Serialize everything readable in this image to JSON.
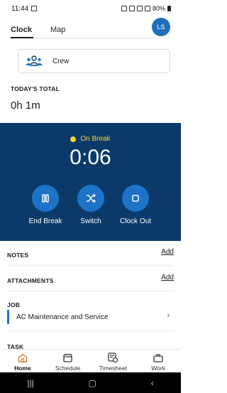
{
  "status_bar": {
    "time": "11:44",
    "battery": "80%"
  },
  "tabs": [
    {
      "label": "Clock",
      "active": true
    },
    {
      "label": "Map",
      "active": false
    }
  ],
  "avatar": {
    "initials": "LS",
    "color": "#1f6fb8"
  },
  "crew": {
    "label": "Crew",
    "icon": "crew-icon"
  },
  "today": {
    "label": "TODAY'S TOTAL",
    "value": "0h 1m"
  },
  "break_panel": {
    "status": "On Break",
    "timer": "0:06",
    "background": "#0b3a6a",
    "status_color": "#f5d13a",
    "actions": [
      {
        "label": "End Break",
        "icon": "pause-icon"
      },
      {
        "label": "Switch",
        "icon": "shuffle-icon"
      },
      {
        "label": "Clock Out",
        "icon": "stop-icon"
      }
    ]
  },
  "sections": {
    "notes": {
      "title": "NOTES",
      "action": "Add"
    },
    "attachments": {
      "title": "ATTACHMENTS",
      "action": "Add"
    },
    "job": {
      "title": "JOB",
      "value": "AC Maintenance and Service"
    },
    "task": {
      "title": "TASK"
    }
  },
  "bottom_nav": [
    {
      "label": "Home",
      "icon": "home-icon",
      "active": true
    },
    {
      "label": "Schedule",
      "icon": "calendar-icon",
      "active": false
    },
    {
      "label": "Timesheet",
      "icon": "timesheet-icon",
      "active": false
    },
    {
      "label": "Work",
      "icon": "briefcase-icon",
      "active": false
    }
  ],
  "accent_color": "#1d74c7"
}
